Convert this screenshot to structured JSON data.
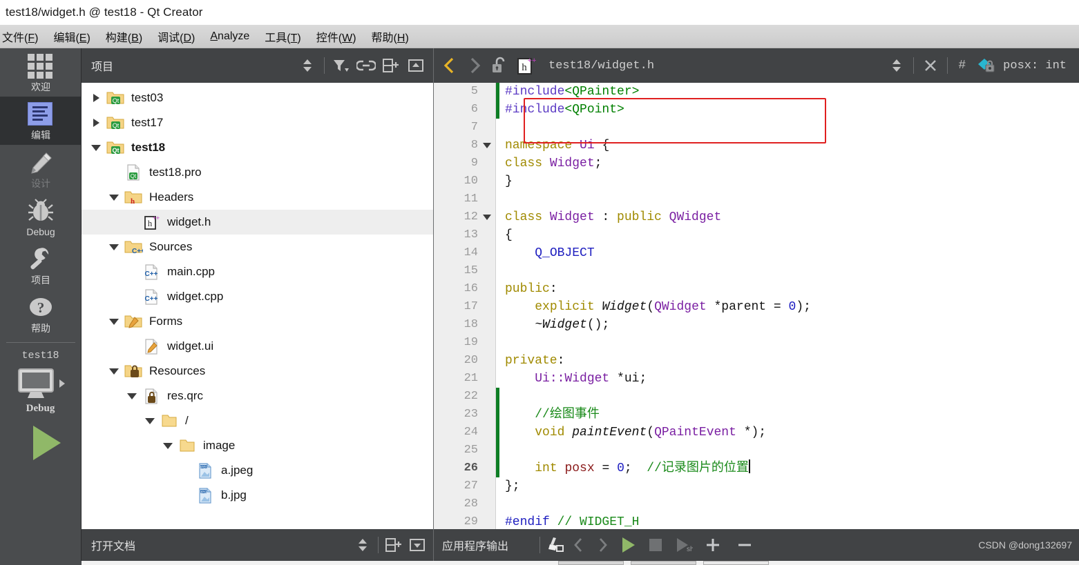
{
  "window": {
    "title": "test18/widget.h @ test18 - Qt Creator"
  },
  "menubar": {
    "items": [
      {
        "pre": "文件(",
        "mn": "F",
        "post": ")"
      },
      {
        "pre": "编辑(",
        "mn": "E",
        "post": ")"
      },
      {
        "pre": "构建(",
        "mn": "B",
        "post": ")"
      },
      {
        "pre": "调试(",
        "mn": "D",
        "post": ")"
      },
      {
        "pre": "",
        "mn": "A",
        "post": "nalyze"
      },
      {
        "pre": "工具(",
        "mn": "T",
        "post": ")"
      },
      {
        "pre": "控件(",
        "mn": "W",
        "post": ")"
      },
      {
        "pre": "帮助(",
        "mn": "H",
        "post": ")"
      }
    ]
  },
  "modebar": {
    "modes": [
      {
        "label": "欢迎",
        "icon": "grid-icon",
        "state": "normal"
      },
      {
        "label": "编辑",
        "icon": "edit-icon",
        "state": "active"
      },
      {
        "label": "设计",
        "icon": "pencil-icon",
        "state": "disabled"
      },
      {
        "label": "Debug",
        "icon": "bug-icon",
        "state": "normal"
      },
      {
        "label": "项目",
        "icon": "wrench-icon",
        "state": "normal"
      },
      {
        "label": "帮助",
        "icon": "question-icon",
        "state": "normal"
      }
    ],
    "kit": {
      "project": "test18",
      "build_config": "Debug",
      "monitor_icon": "desktop-monitor-icon",
      "run_icon": "run-triangle-icon"
    }
  },
  "project_panel": {
    "title": "项目",
    "toolbar": [
      {
        "name": "sync-stepper",
        "icon": "up-down-stepper-icon"
      },
      {
        "name": "filter-button",
        "icon": "filter-funnel-icon"
      },
      {
        "name": "link-button",
        "icon": "link-chain-icon"
      },
      {
        "name": "split-button",
        "icon": "split-add-icon"
      },
      {
        "name": "close-split-button",
        "icon": "collapse-icon"
      }
    ],
    "tree": [
      {
        "label": "test03",
        "indent": 0,
        "twist": "closed",
        "icon": "qt-project-folder-icon",
        "selected": false,
        "bold": false
      },
      {
        "label": "test17",
        "indent": 0,
        "twist": "closed",
        "icon": "qt-project-folder-icon",
        "selected": false,
        "bold": false
      },
      {
        "label": "test18",
        "indent": 0,
        "twist": "open",
        "icon": "qt-project-folder-icon",
        "selected": false,
        "bold": true
      },
      {
        "label": "test18.pro",
        "indent": 1,
        "twist": "none",
        "icon": "qt-pro-file-icon",
        "selected": false,
        "bold": false
      },
      {
        "label": "Headers",
        "indent": 1,
        "twist": "open",
        "icon": "headers-folder-icon",
        "selected": false,
        "bold": false
      },
      {
        "label": "widget.h",
        "indent": 2,
        "twist": "none",
        "icon": "h-plus-plus-file-icon",
        "selected": true,
        "bold": false
      },
      {
        "label": "Sources",
        "indent": 1,
        "twist": "open",
        "icon": "sources-folder-icon",
        "selected": false,
        "bold": false
      },
      {
        "label": "main.cpp",
        "indent": 2,
        "twist": "none",
        "icon": "cpp-file-icon",
        "selected": false,
        "bold": false
      },
      {
        "label": "widget.cpp",
        "indent": 2,
        "twist": "none",
        "icon": "cpp-file-icon",
        "selected": false,
        "bold": false
      },
      {
        "label": "Forms",
        "indent": 1,
        "twist": "open",
        "icon": "forms-folder-icon",
        "selected": false,
        "bold": false
      },
      {
        "label": "widget.ui",
        "indent": 2,
        "twist": "none",
        "icon": "ui-file-icon",
        "selected": false,
        "bold": false
      },
      {
        "label": "Resources",
        "indent": 1,
        "twist": "open",
        "icon": "resources-folder-icon",
        "selected": false,
        "bold": false
      },
      {
        "label": "res.qrc",
        "indent": 2,
        "twist": "open",
        "icon": "qrc-file-icon",
        "selected": false,
        "bold": false
      },
      {
        "label": "/",
        "indent": 3,
        "twist": "open",
        "icon": "folder-icon",
        "selected": false,
        "bold": false
      },
      {
        "label": "image",
        "indent": 4,
        "twist": "open",
        "icon": "folder-icon",
        "selected": false,
        "bold": false
      },
      {
        "label": "a.jpeg",
        "indent": 5,
        "twist": "none",
        "icon": "jpeg-image-icon",
        "selected": false,
        "bold": false
      },
      {
        "label": "b.jpg",
        "indent": 5,
        "twist": "none",
        "icon": "jpg-image-icon",
        "selected": false,
        "bold": false
      }
    ]
  },
  "editor": {
    "toolbar": {
      "back_icon": "back-chevron-icon",
      "forward_icon": "forward-chevron-icon",
      "lock_icon": "unlocked-padlock-icon",
      "file_icon": "h-plus-plus-file-icon",
      "file_path": "test18/widget.h",
      "stepper_icon": "up-down-stepper-icon",
      "close_icon": "close-x-icon",
      "hash_label": "#",
      "symbol_icon": "private-member-lock-icon",
      "symbol_label": "posx: int"
    },
    "lines": [
      {
        "n": "5",
        "fold": false,
        "mod": true,
        "current": false,
        "tokens": [
          {
            "t": "#include",
            "c": "k-pre"
          },
          {
            "t": "<QPainter>",
            "c": "k-str"
          }
        ]
      },
      {
        "n": "6",
        "fold": false,
        "mod": true,
        "current": false,
        "tokens": [
          {
            "t": "#include",
            "c": "k-pre"
          },
          {
            "t": "<QPoint>",
            "c": "k-str"
          }
        ]
      },
      {
        "n": "7",
        "fold": false,
        "mod": false,
        "current": false,
        "tokens": []
      },
      {
        "n": "8",
        "fold": true,
        "mod": false,
        "current": false,
        "tokens": [
          {
            "t": "namespace ",
            "c": "k-key"
          },
          {
            "t": "Ui",
            "c": "k-type"
          },
          {
            "t": " {",
            "c": "k-plain"
          }
        ]
      },
      {
        "n": "9",
        "fold": false,
        "mod": false,
        "current": false,
        "tokens": [
          {
            "t": "class ",
            "c": "k-key"
          },
          {
            "t": "Widget",
            "c": "k-type"
          },
          {
            "t": ";",
            "c": "k-plain"
          }
        ]
      },
      {
        "n": "10",
        "fold": false,
        "mod": false,
        "current": false,
        "tokens": [
          {
            "t": "}",
            "c": "k-plain"
          }
        ]
      },
      {
        "n": "11",
        "fold": false,
        "mod": false,
        "current": false,
        "tokens": []
      },
      {
        "n": "12",
        "fold": true,
        "mod": false,
        "current": false,
        "tokens": [
          {
            "t": "class ",
            "c": "k-key"
          },
          {
            "t": "Widget",
            "c": "k-type"
          },
          {
            "t": " : ",
            "c": "k-plain"
          },
          {
            "t": "public",
            "c": "k-key"
          },
          {
            "t": " ",
            "c": "k-plain"
          },
          {
            "t": "QWidget",
            "c": "k-type"
          }
        ]
      },
      {
        "n": "13",
        "fold": false,
        "mod": false,
        "current": false,
        "tokens": [
          {
            "t": "{",
            "c": "k-plain"
          }
        ]
      },
      {
        "n": "14",
        "fold": false,
        "mod": false,
        "current": false,
        "tokens": [
          {
            "t": "    ",
            "c": "k-plain"
          },
          {
            "t": "Q_OBJECT",
            "c": "k-macro"
          }
        ]
      },
      {
        "n": "15",
        "fold": false,
        "mod": false,
        "current": false,
        "tokens": []
      },
      {
        "n": "16",
        "fold": false,
        "mod": false,
        "current": false,
        "tokens": [
          {
            "t": "public",
            "c": "k-key"
          },
          {
            "t": ":",
            "c": "k-plain"
          }
        ]
      },
      {
        "n": "17",
        "fold": false,
        "mod": false,
        "current": false,
        "tokens": [
          {
            "t": "    ",
            "c": "k-plain"
          },
          {
            "t": "explicit ",
            "c": "k-key"
          },
          {
            "t": "Widget",
            "c": "k-fn"
          },
          {
            "t": "(",
            "c": "k-plain"
          },
          {
            "t": "QWidget",
            "c": "k-type"
          },
          {
            "t": " *parent = ",
            "c": "k-plain"
          },
          {
            "t": "0",
            "c": "k-num"
          },
          {
            "t": ");",
            "c": "k-plain"
          }
        ]
      },
      {
        "n": "18",
        "fold": false,
        "mod": false,
        "current": false,
        "tokens": [
          {
            "t": "    ",
            "c": "k-plain"
          },
          {
            "t": "~Widget",
            "c": "k-fn"
          },
          {
            "t": "();",
            "c": "k-plain"
          }
        ]
      },
      {
        "n": "19",
        "fold": false,
        "mod": false,
        "current": false,
        "tokens": []
      },
      {
        "n": "20",
        "fold": false,
        "mod": false,
        "current": false,
        "tokens": [
          {
            "t": "private",
            "c": "k-key"
          },
          {
            "t": ":",
            "c": "k-plain"
          }
        ]
      },
      {
        "n": "21",
        "fold": false,
        "mod": false,
        "current": false,
        "tokens": [
          {
            "t": "    ",
            "c": "k-plain"
          },
          {
            "t": "Ui::Widget",
            "c": "k-type"
          },
          {
            "t": " *ui;",
            "c": "k-plain"
          }
        ]
      },
      {
        "n": "22",
        "fold": false,
        "mod": true,
        "current": false,
        "tokens": []
      },
      {
        "n": "23",
        "fold": false,
        "mod": true,
        "current": false,
        "tokens": [
          {
            "t": "    ",
            "c": "k-plain"
          },
          {
            "t": "//绘图事件",
            "c": "k-cmt"
          }
        ]
      },
      {
        "n": "24",
        "fold": false,
        "mod": true,
        "current": false,
        "tokens": [
          {
            "t": "    ",
            "c": "k-plain"
          },
          {
            "t": "void ",
            "c": "k-key"
          },
          {
            "t": "paintEvent",
            "c": "k-fn"
          },
          {
            "t": "(",
            "c": "k-plain"
          },
          {
            "t": "QPaintEvent",
            "c": "k-type"
          },
          {
            "t": " *);",
            "c": "k-plain"
          }
        ]
      },
      {
        "n": "25",
        "fold": false,
        "mod": true,
        "current": false,
        "tokens": []
      },
      {
        "n": "26",
        "fold": false,
        "mod": true,
        "current": true,
        "tokens": [
          {
            "t": "    ",
            "c": "k-plain"
          },
          {
            "t": "int ",
            "c": "k-key"
          },
          {
            "t": "posx",
            "c": "k-field"
          },
          {
            "t": " = ",
            "c": "k-plain"
          },
          {
            "t": "0",
            "c": "k-num"
          },
          {
            "t": ";  ",
            "c": "k-plain"
          },
          {
            "t": "//记录图片的位置",
            "c": "k-cmt"
          }
        ],
        "caret": true
      },
      {
        "n": "27",
        "fold": false,
        "mod": false,
        "current": false,
        "tokens": [
          {
            "t": "};",
            "c": "k-plain"
          }
        ]
      },
      {
        "n": "28",
        "fold": false,
        "mod": false,
        "current": false,
        "tokens": []
      },
      {
        "n": "29",
        "fold": false,
        "mod": false,
        "current": false,
        "tokens": [
          {
            "t": "#endif",
            "c": "k-macro"
          },
          {
            "t": " ",
            "c": "k-plain"
          },
          {
            "t": "// WIDGET_H",
            "c": "k-cmt"
          }
        ]
      }
    ]
  },
  "bottom": {
    "open_documents_label": "打开文档",
    "open_documents_toolbar": [
      {
        "name": "open-docs-stepper",
        "icon": "up-down-stepper-icon"
      },
      {
        "name": "open-docs-split",
        "icon": "split-add-icon"
      },
      {
        "name": "open-docs-close",
        "icon": "collapse-down-icon"
      }
    ],
    "app_output_label": "应用程序输出",
    "output_toolbar": [
      {
        "name": "clear-output-button",
        "icon": "broom-clear-icon"
      },
      {
        "name": "prev-item-button",
        "icon": "back-chevron-icon"
      },
      {
        "name": "next-item-button",
        "icon": "forward-chevron-icon"
      },
      {
        "name": "run-button",
        "icon": "run-triangle-icon"
      },
      {
        "name": "stop-button",
        "icon": "stop-square-icon"
      },
      {
        "name": "attach-debugger-button",
        "icon": "run-debug-icon"
      },
      {
        "name": "zoom-in-button",
        "icon": "plus-icon"
      },
      {
        "name": "zoom-out-button",
        "icon": "minus-icon"
      }
    ],
    "watermark": "CSDN @dong132697"
  },
  "colors": {
    "toolbar_dark": "#414345",
    "modebar": "#4a4c4e",
    "mode_active": "#2f3133",
    "accent_yellow": "#e8b427",
    "run_green": "#90b868",
    "highlight_red": "#e02020",
    "change_green": "#0d7d24",
    "edit_icon_blue": "#8d9de8",
    "symbol_cyan": "#29b6d0"
  }
}
